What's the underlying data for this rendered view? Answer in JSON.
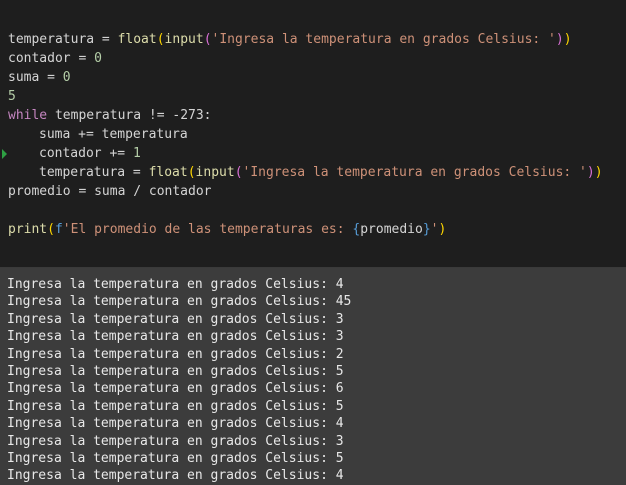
{
  "code": {
    "l1": {
      "var": "temperatura",
      "op": " = ",
      "fn1": "float",
      "p1": "(",
      "fn2": "input",
      "p2": "(",
      "str": "'Ingresa la temperatura en grados Celsius: '",
      "p3": ")",
      "p4": ")"
    },
    "l2": {
      "var": "contador",
      "op": " = ",
      "num": "0"
    },
    "l3": {
      "var": "suma",
      "op": " = ",
      "num": "0"
    },
    "l4": {
      "num": "5"
    },
    "l5": {
      "kw": "while",
      "rest": " temperatura != -273:"
    },
    "l6": {
      "text": "suma += temperatura"
    },
    "l7": {
      "var": "contador",
      "op": " += ",
      "num": "1"
    },
    "l8": {
      "var": "temperatura",
      "op": " = ",
      "fn1": "float",
      "p1": "(",
      "fn2": "input",
      "p2": "(",
      "str": "'Ingresa la temperatura en grados Celsius: '",
      "p3": ")",
      "p4": ")"
    },
    "l9": {
      "text": "promedio = suma / contador"
    },
    "l10": {
      "fn": "print",
      "p1": "(",
      "fprefix": "f",
      "str1": "'El promedio de las temperaturas es: ",
      "b1": "{",
      "var": "promedio",
      "b2": "}",
      "str2": "'",
      "p2": ")"
    }
  },
  "terminal": {
    "lines": [
      "Ingresa la temperatura en grados Celsius: 4",
      "Ingresa la temperatura en grados Celsius: 45",
      "Ingresa la temperatura en grados Celsius: 3",
      "Ingresa la temperatura en grados Celsius: 3",
      "Ingresa la temperatura en grados Celsius: 2",
      "Ingresa la temperatura en grados Celsius: 5",
      "Ingresa la temperatura en grados Celsius: 6",
      "Ingresa la temperatura en grados Celsius: 5",
      "Ingresa la temperatura en grados Celsius: 4",
      "Ingresa la temperatura en grados Celsius: 3",
      "Ingresa la temperatura en grados Celsius: 5",
      "Ingresa la temperatura en grados Celsius: 4"
    ]
  },
  "colors": {
    "editor_bg": "#1e1e1e",
    "terminal_bg": "#3c3c3c",
    "keyword": "#c586c0",
    "function": "#dcdcaa",
    "string": "#ce9178",
    "number": "#b5cea8",
    "gutter_marker": "#2ea043"
  },
  "icons": {
    "gutter": "breakpoint-arrow-icon"
  }
}
